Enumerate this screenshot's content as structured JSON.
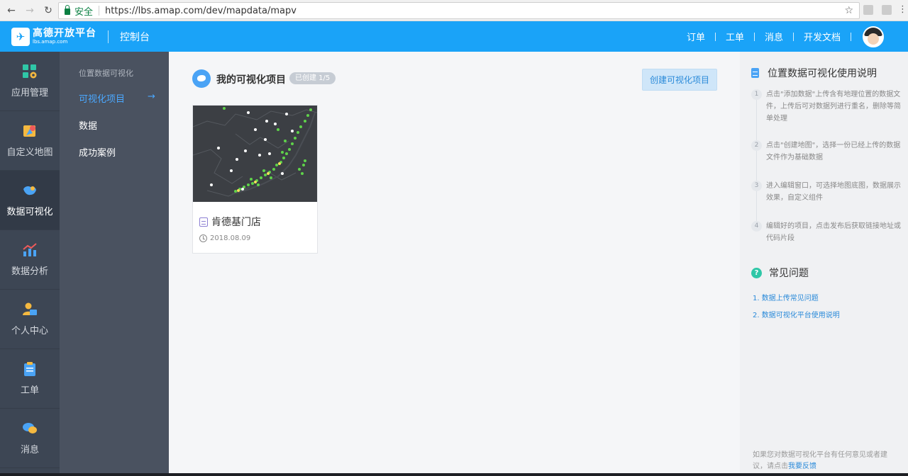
{
  "browser": {
    "secure_label": "安全",
    "url": "https://lbs.amap.com/dev/mapdata/mapv"
  },
  "header": {
    "logo_cn": "高德开放平台",
    "logo_en": "lbs.amap.com",
    "console": "控制台",
    "nav": [
      "订单",
      "工单",
      "消息",
      "开发文档"
    ]
  },
  "sidebar": {
    "items": [
      {
        "label": "应用管理",
        "icon": "app-grid-icon"
      },
      {
        "label": "自定义地图",
        "icon": "custom-map-icon"
      },
      {
        "label": "数据可视化",
        "icon": "china-map-icon"
      },
      {
        "label": "数据分析",
        "icon": "chart-icon"
      },
      {
        "label": "个人中心",
        "icon": "person-icon"
      },
      {
        "label": "工单",
        "icon": "clipboard-icon"
      },
      {
        "label": "消息",
        "icon": "chat-icon"
      }
    ]
  },
  "subnav": {
    "title": "位置数据可视化",
    "items": [
      "可视化项目",
      "数据",
      "成功案例"
    ],
    "arrow": "→"
  },
  "main": {
    "title": "我的可视化项目",
    "badge": "已创建 1/5",
    "create_button": "创建可视化项目",
    "card": {
      "name": "肯德基门店",
      "date": "2018.08.09"
    }
  },
  "help": {
    "title": "位置数据可视化使用说明",
    "steps": [
      {
        "num": "1",
        "text": "点击\"添加数据\"上传含有地理位置的数据文件，上传后可对数据列进行重名，删除等简单处理"
      },
      {
        "num": "2",
        "text": "点击\"创建地图\"，选择一份已经上传的数据文件作为基础数据"
      },
      {
        "num": "3",
        "text": "进入编辑窗口，可选择地图底图，数据展示效果，自定义组件"
      },
      {
        "num": "4",
        "text": "编辑好的项目，点击发布后获取链接地址或代码片段"
      }
    ],
    "faq_title": "常见问题",
    "faq": [
      "1. 数据上传常见问题",
      "2. 数据可视化平台使用说明"
    ],
    "feedback_text": "如果您对数据可视化平台有任何意见或者建议，请点击",
    "feedback_link": "我要反馈"
  },
  "colors": {
    "header_blue": "#1aa3f8",
    "sidebar_dark": "#3d4654",
    "subnav": "#4a5260",
    "accent_blue": "#2a8ad9",
    "faq_green": "#2fc7a7"
  }
}
